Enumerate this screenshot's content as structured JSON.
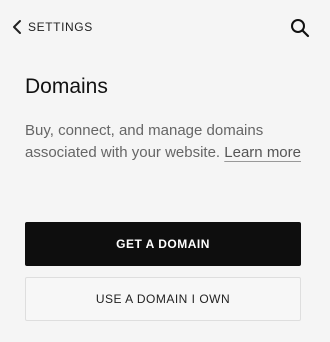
{
  "header": {
    "back_label": "SETTINGS",
    "back_icon": "chevron-left-icon",
    "search_icon": "search-icon"
  },
  "main": {
    "title": "Domains",
    "description": "Buy, connect, and manage domains associated with your website.",
    "learn_more_label": "Learn more",
    "primary_button_label": "GET A DOMAIN",
    "secondary_button_label": "USE A DOMAIN I OWN"
  },
  "colors": {
    "background": "#f5f5f5",
    "primary_button": "#0e0e0e",
    "primary_button_text": "#ffffff",
    "secondary_button_border": "#dedede",
    "body_text": "#666666"
  }
}
